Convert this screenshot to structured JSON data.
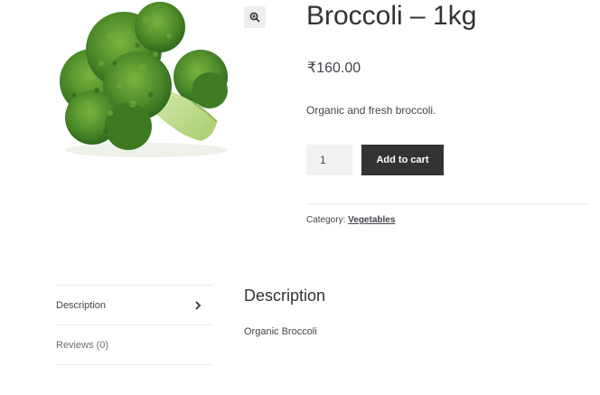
{
  "product": {
    "title": "Broccoli – 1kg",
    "price": "₹160.00",
    "short_description": "Organic and fresh broccoli.",
    "image_icon": "broccoli-product-image",
    "zoom_icon": "magnifier-plus-icon"
  },
  "cart": {
    "quantity": "1",
    "add_to_cart_label": "Add to cart"
  },
  "meta": {
    "category_label": "Category:",
    "category_value": "Vegetables"
  },
  "tabs": {
    "items": [
      {
        "label": "Description",
        "active": true,
        "icon": "chevron-right-icon"
      },
      {
        "label": "Reviews (0)",
        "active": false
      }
    ],
    "panel_heading": "Description",
    "panel_text": "Organic Broccoli"
  },
  "colors": {
    "button_bg": "#333333",
    "button_text": "#ffffff",
    "body_text": "#43454b",
    "broccoli_green": "#4e8a2a",
    "stem_green": "#b9d98f"
  }
}
